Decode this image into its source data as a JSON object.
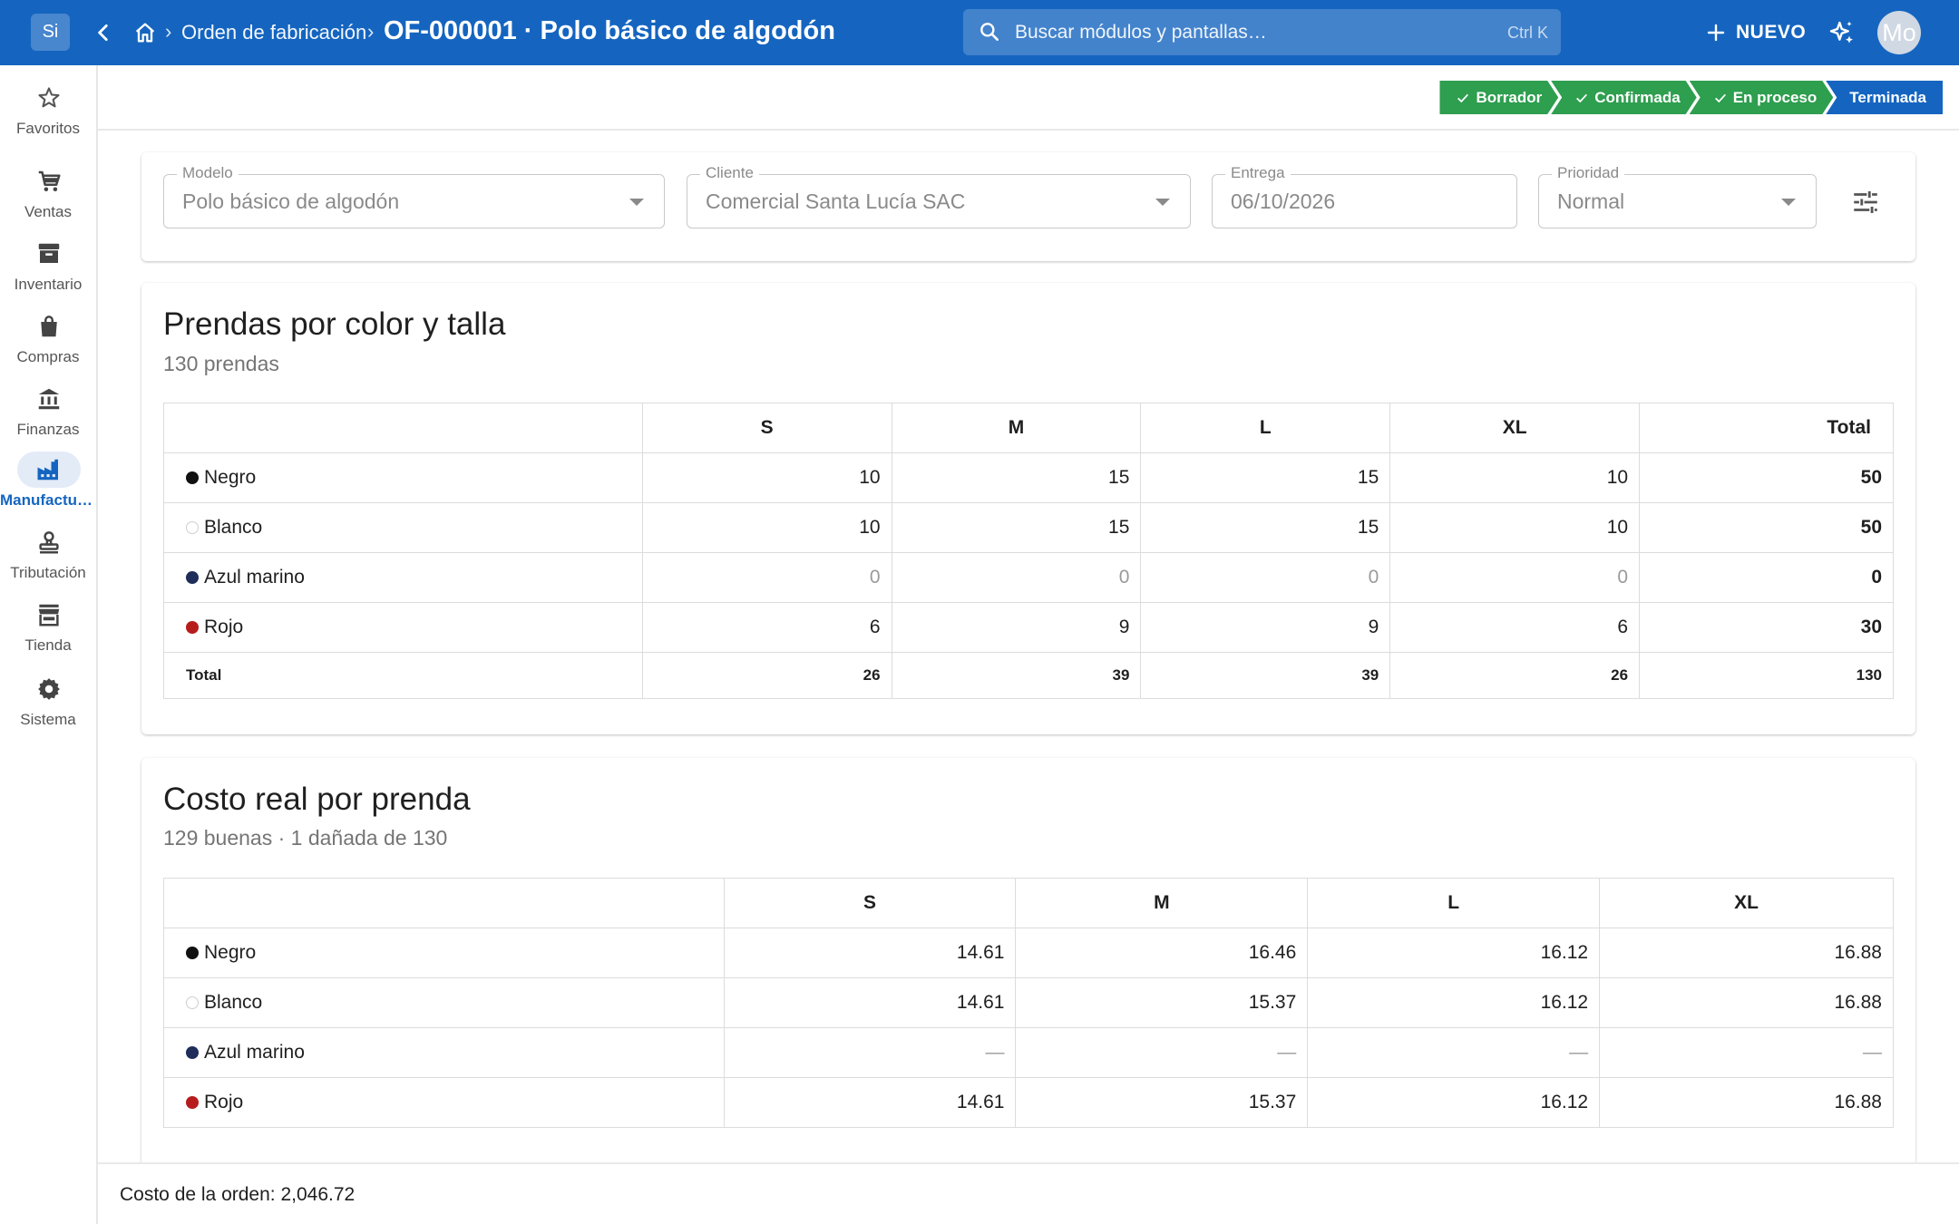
{
  "topbar": {
    "app_chip": "Si",
    "breadcrumb": "Orden de fabricación",
    "title": "OF-000001 · Polo básico de algodón",
    "search_placeholder": "Buscar módulos y pantallas…",
    "search_shortcut": "Ctrl K",
    "new_label": "NUEVO",
    "avatar": "Mo"
  },
  "sidebar": {
    "items": [
      {
        "label": "Favoritos",
        "icon": "star-icon"
      },
      {
        "label": "Ventas",
        "icon": "cart-icon"
      },
      {
        "label": "Inventario",
        "icon": "archive-icon"
      },
      {
        "label": "Compras",
        "icon": "shopping-bag-icon"
      },
      {
        "label": "Finanzas",
        "icon": "bank-icon"
      },
      {
        "label": "Manufacturación",
        "icon": "factory-icon",
        "active": true
      },
      {
        "label": "Tributación",
        "icon": "stamp-icon"
      },
      {
        "label": "Tienda",
        "icon": "store-icon"
      },
      {
        "label": "Sistema",
        "icon": "gear-icon"
      }
    ]
  },
  "status_steps": [
    {
      "label": "Borrador",
      "done": true
    },
    {
      "label": "Confirmada",
      "done": true
    },
    {
      "label": "En proceso",
      "done": true
    },
    {
      "label": "Terminada",
      "done": false,
      "current": true
    }
  ],
  "form": {
    "modelo": {
      "label": "Modelo",
      "value": "Polo básico de algodón"
    },
    "cliente": {
      "label": "Cliente",
      "value": "Comercial Santa Lucía SAC"
    },
    "entrega": {
      "label": "Entrega",
      "value": "06/10/2026"
    },
    "prioridad": {
      "label": "Prioridad",
      "value": "Normal"
    }
  },
  "prendas": {
    "title": "Prendas por color y talla",
    "subtitle": "130 prendas",
    "columns": [
      "S",
      "M",
      "L",
      "XL",
      "Total"
    ],
    "rows": [
      {
        "color": "Negro",
        "dot": "#111111",
        "values": [
          "10",
          "15",
          "15",
          "10"
        ],
        "total": "50"
      },
      {
        "color": "Blanco",
        "dot": "#ffffff",
        "values": [
          "10",
          "15",
          "15",
          "10"
        ],
        "total": "50"
      },
      {
        "color": "Azul marino",
        "dot": "#1f2d5a",
        "values": [
          "0",
          "0",
          "0",
          "0"
        ],
        "total": "0"
      },
      {
        "color": "Rojo",
        "dot": "#b71c1c",
        "values": [
          "6",
          "9",
          "9",
          "6"
        ],
        "total": "30"
      }
    ],
    "total_row": {
      "label": "Total",
      "values": [
        "26",
        "39",
        "39",
        "26"
      ],
      "total": "130"
    }
  },
  "costo": {
    "title": "Costo real por prenda",
    "subtitle": "129 buenas · 1 dañada de 130",
    "columns": [
      "S",
      "M",
      "L",
      "XL"
    ],
    "rows": [
      {
        "color": "Negro",
        "dot": "#111111",
        "values": [
          "14.61",
          "16.46",
          "16.12",
          "16.88"
        ]
      },
      {
        "color": "Blanco",
        "dot": "#ffffff",
        "values": [
          "14.61",
          "15.37",
          "16.12",
          "16.88"
        ]
      },
      {
        "color": "Azul marino",
        "dot": "#1f2d5a",
        "values": [
          "—",
          "—",
          "—",
          "—"
        ]
      },
      {
        "color": "Rojo",
        "dot": "#b71c1c",
        "values": [
          "14.61",
          "15.37",
          "16.12",
          "16.88"
        ]
      }
    ]
  },
  "footer": {
    "text": "Costo de la orden: 2,046.72"
  }
}
